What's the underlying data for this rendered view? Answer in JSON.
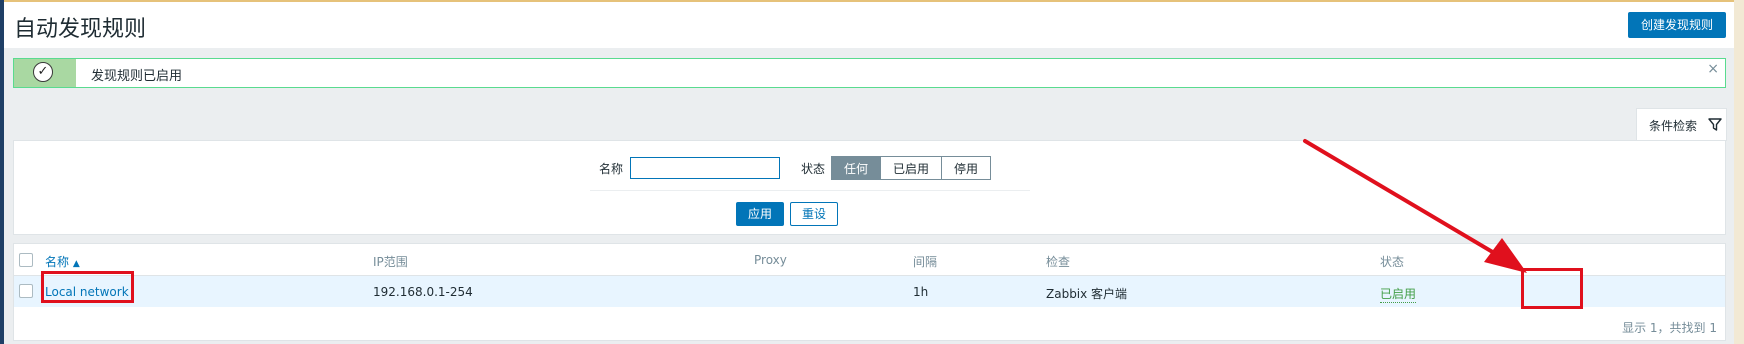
{
  "header": {
    "title": "自动发现规则",
    "create_button": "创建发现规则"
  },
  "message": {
    "text": "发现规则已启用",
    "close": "×"
  },
  "filter": {
    "tab_label": "条件检索",
    "name_label": "名称",
    "name_value": "",
    "status_label": "状态",
    "status_options": [
      "任何",
      "已启用",
      "停用"
    ],
    "status_selected": "任何",
    "apply": "应用",
    "reset": "重设"
  },
  "table": {
    "columns": [
      "名称",
      "IP范围",
      "Proxy",
      "间隔",
      "检查",
      "状态"
    ],
    "sort_column": "名称",
    "sort_icon": "▲",
    "rows": [
      {
        "name": "Local network",
        "ip_range": "192.168.0.1-254",
        "proxy": "",
        "interval": "1h",
        "checks": "Zabbix 客户端",
        "status": "已启用"
      }
    ],
    "footer": "显示 1，共找到 1"
  },
  "annotations": {
    "highlight_color": "#e0101d"
  },
  "colors": {
    "accent": "#0275b8",
    "success_border": "#59db8f",
    "enabled_status": "#429e47"
  }
}
